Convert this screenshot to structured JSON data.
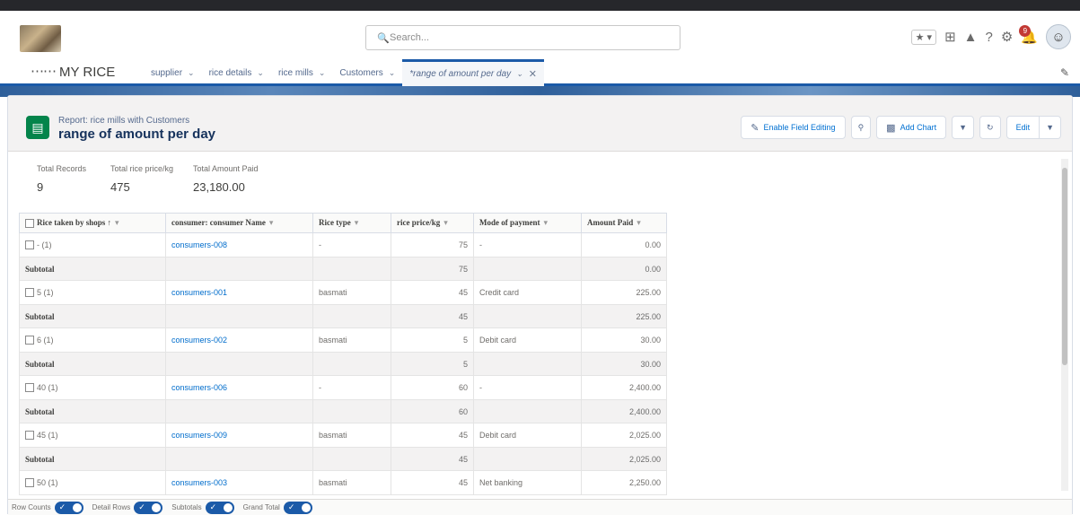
{
  "header": {
    "search_placeholder": "Search...",
    "notification_count": "9"
  },
  "nav": {
    "app_name": "MY RICE",
    "tabs": [
      {
        "label": "supplier"
      },
      {
        "label": "rice details"
      },
      {
        "label": "rice mills"
      },
      {
        "label": "Customers"
      }
    ],
    "active_tab": "*range of amount per day"
  },
  "report": {
    "subtitle": "Report: rice mills with Customers",
    "title": "range of amount per day",
    "buttons": {
      "enable_field_editing": "Enable Field Editing",
      "add_chart": "Add Chart",
      "edit": "Edit"
    }
  },
  "summary": [
    {
      "label": "Total Records",
      "value": "9"
    },
    {
      "label": "Total rice price/kg",
      "value": "475"
    },
    {
      "label": "Total Amount Paid",
      "value": "23,180.00"
    }
  ],
  "table": {
    "headers": [
      "Rice taken by shops ↑",
      "consumer: consumer Name",
      "Rice type",
      "rice price/kg",
      "Mode of payment",
      "Amount Paid"
    ],
    "groups": [
      {
        "group": "- (1)",
        "name": "consumers-008",
        "type": "-",
        "price": "75",
        "mode": "-",
        "amount": "0.00",
        "sub_price": "75",
        "sub_amount": "0.00"
      },
      {
        "group": "5 (1)",
        "name": "consumers-001",
        "type": "basmati",
        "price": "45",
        "mode": "Credit card",
        "amount": "225.00",
        "sub_price": "45",
        "sub_amount": "225.00"
      },
      {
        "group": "6 (1)",
        "name": "consumers-002",
        "type": "basmati",
        "price": "5",
        "mode": "Debit card",
        "amount": "30.00",
        "sub_price": "5",
        "sub_amount": "30.00"
      },
      {
        "group": "40 (1)",
        "name": "consumers-006",
        "type": "-",
        "price": "60",
        "mode": "-",
        "amount": "2,400.00",
        "sub_price": "60",
        "sub_amount": "2,400.00"
      },
      {
        "group": "45 (1)",
        "name": "consumers-009",
        "type": "basmati",
        "price": "45",
        "mode": "Debit card",
        "amount": "2,025.00",
        "sub_price": "45",
        "sub_amount": "2,025.00"
      },
      {
        "group": "50 (1)",
        "name": "consumers-003",
        "type": "basmati",
        "price": "45",
        "mode": "Net banking",
        "amount": "2,250.00"
      }
    ],
    "subtotal_label": "Subtotal"
  },
  "footer": {
    "toggles": [
      "Row Counts",
      "Detail Rows",
      "Subtotals",
      "Grand Total"
    ]
  },
  "colors": {
    "accent": "#1b5aa8",
    "report_icon": "#04844b",
    "link": "#006dcc"
  }
}
